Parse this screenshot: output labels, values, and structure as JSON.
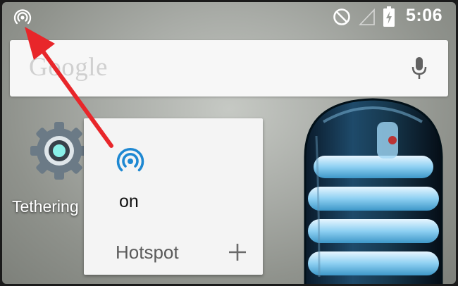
{
  "status_bar": {
    "time": "5:06",
    "icons": [
      "hotspot-icon",
      "do-not-disturb-icon",
      "signal-icon",
      "battery-charging-icon"
    ]
  },
  "search": {
    "logo_text": "Google",
    "mic_icon": "mic-icon"
  },
  "home_apps": [
    {
      "label": "Tethering",
      "icon": "gear-icon"
    }
  ],
  "hotspot_widget": {
    "icon": "hotspot-icon",
    "state": "on",
    "title": "Hotspot",
    "add_icon": "plus-icon"
  },
  "annotation": {
    "arrow_color": "#e8262a"
  },
  "colors": {
    "accent": "#1e88d2",
    "status_text": "#ffffff"
  }
}
